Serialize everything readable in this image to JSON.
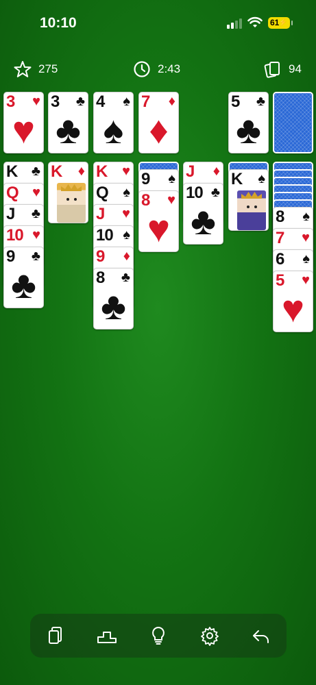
{
  "status_bar": {
    "time": "10:10",
    "battery": "61"
  },
  "stats": {
    "score": "275",
    "time": "2:43",
    "stock_count": "94"
  },
  "icons": {
    "score": "star-icon",
    "timer": "clock-icon",
    "stock": "cards-icon"
  },
  "foundations": [
    {
      "rank": "3",
      "suit": "♥",
      "color": "red"
    },
    {
      "rank": "3",
      "suit": "♣",
      "color": "black"
    },
    {
      "rank": "4",
      "suit": "♠",
      "color": "black"
    },
    {
      "rank": "7",
      "suit": "♦",
      "color": "red"
    }
  ],
  "waste": {
    "rank": "5",
    "suit": "♣",
    "color": "black"
  },
  "stock": {
    "face_down": true
  },
  "tableau": [
    {
      "cards": [
        {
          "rank": "K",
          "suit": "♣",
          "color": "black"
        },
        {
          "rank": "Q",
          "suit": "♥",
          "color": "red"
        },
        {
          "rank": "J",
          "suit": "♣",
          "color": "black"
        },
        {
          "rank": "10",
          "suit": "♥",
          "color": "red"
        },
        {
          "rank": "9",
          "suit": "♣",
          "color": "black"
        }
      ]
    },
    {
      "cards": [
        {
          "rank": "K",
          "suit": "♦",
          "color": "red",
          "face": "king-d"
        }
      ]
    },
    {
      "cards": [
        {
          "rank": "K",
          "suit": "♥",
          "color": "red"
        },
        {
          "rank": "Q",
          "suit": "♠",
          "color": "black"
        },
        {
          "rank": "J",
          "suit": "♥",
          "color": "red"
        },
        {
          "rank": "10",
          "suit": "♠",
          "color": "black"
        },
        {
          "rank": "9",
          "suit": "♦",
          "color": "red"
        },
        {
          "rank": "8",
          "suit": "♣",
          "color": "black"
        }
      ]
    },
    {
      "hidden": 1,
      "cards": [
        {
          "rank": "9",
          "suit": "♠",
          "color": "black"
        },
        {
          "rank": "8",
          "suit": "♥",
          "color": "red"
        }
      ]
    },
    {
      "cards": [
        {
          "rank": "J",
          "suit": "♦",
          "color": "red"
        },
        {
          "rank": "10",
          "suit": "♣",
          "color": "black"
        }
      ]
    },
    {
      "hidden": 1,
      "cards": [
        {
          "rank": "K",
          "suit": "♠",
          "color": "black",
          "face": "king-s"
        }
      ]
    },
    {
      "hidden": 6,
      "cards": [
        {
          "rank": "8",
          "suit": "♠",
          "color": "black"
        },
        {
          "rank": "7",
          "suit": "♥",
          "color": "red"
        },
        {
          "rank": "6",
          "suit": "♠",
          "color": "black"
        },
        {
          "rank": "5",
          "suit": "♥",
          "color": "red"
        }
      ]
    }
  ],
  "toolbar": [
    "cards-icon",
    "podium-icon",
    "lightbulb-icon",
    "gear-icon",
    "undo-icon"
  ]
}
